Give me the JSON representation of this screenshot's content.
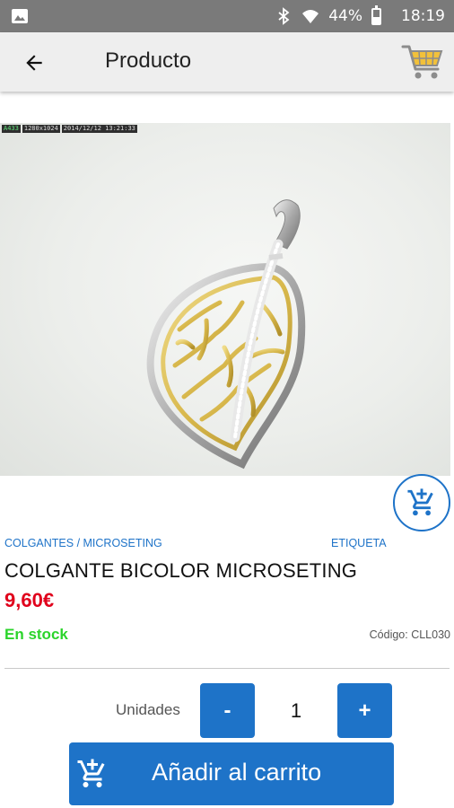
{
  "status_bar": {
    "battery": "44%",
    "time": "18:19",
    "battery_level": 0.44
  },
  "app_bar": {
    "title": "Producto"
  },
  "image": {
    "meta": [
      "A433",
      "1280x1024",
      "2014/12/12 13:21:33"
    ]
  },
  "product": {
    "category": "COLGANTES / MICROSETING",
    "tag": "ETIQUETA",
    "name": "COLGANTE BICOLOR MICROSETING",
    "price": "9,60€",
    "stock": "En stock",
    "code": "Código: CLL030"
  },
  "quantity": {
    "label": "Unidades",
    "minus": "-",
    "value": "1",
    "plus": "+"
  },
  "actions": {
    "add_to_cart": "Añadir al carrito"
  },
  "icons": {
    "back": "arrow-left-icon",
    "cart": "shopping-cart-icon",
    "add_cart": "cart-plus-icon"
  },
  "colors": {
    "accent": "#1e73c8",
    "price": "#e0001b",
    "stock": "#2bd42b",
    "status_bar": "#7a7a7a",
    "app_bar": "#eeeeee"
  }
}
